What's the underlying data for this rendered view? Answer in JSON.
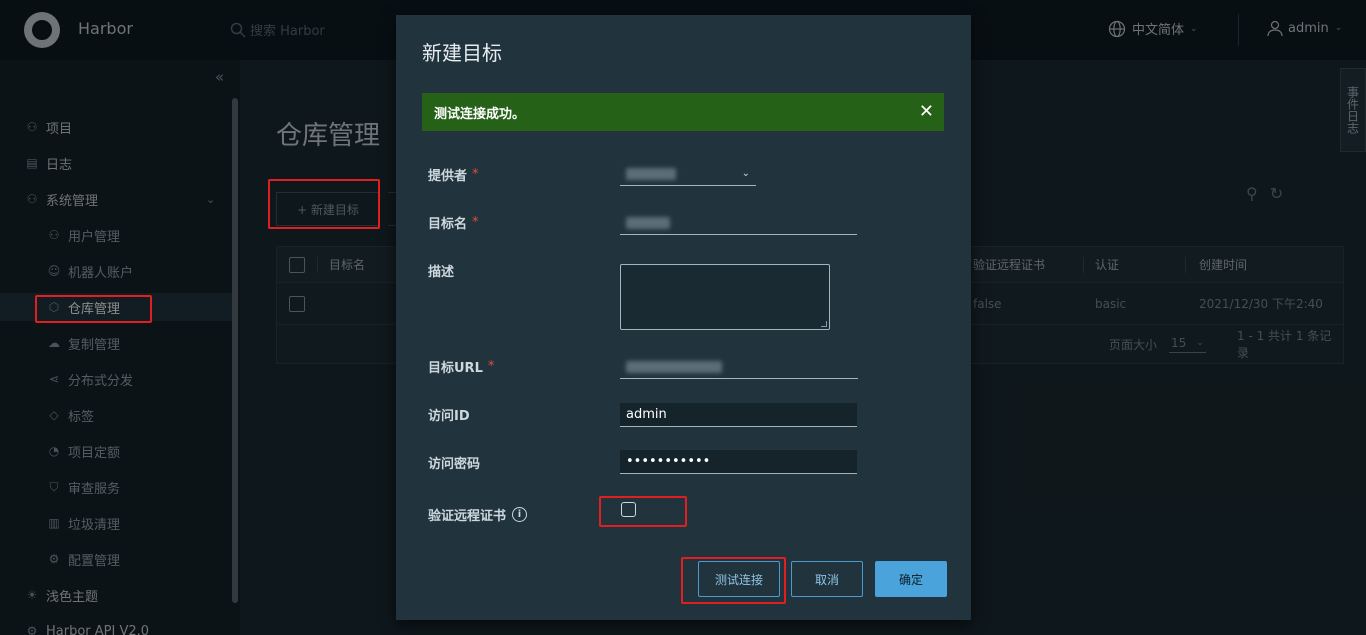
{
  "header": {
    "app_title": "Harbor",
    "search_placeholder": "搜索 Harbor",
    "language": "中文简体",
    "user": "admin"
  },
  "sidebar": {
    "items": [
      {
        "label": "项目",
        "icon": "projects-icon"
      },
      {
        "label": "日志",
        "icon": "logs-icon"
      },
      {
        "label": "系统管理",
        "icon": "admin-icon"
      },
      {
        "label": "用户管理",
        "icon": "users-icon"
      },
      {
        "label": "机器人账户",
        "icon": "robot-icon"
      },
      {
        "label": "仓库管理",
        "icon": "registry-icon"
      },
      {
        "label": "复制管理",
        "icon": "replication-icon"
      },
      {
        "label": "分布式分发",
        "icon": "distribution-icon"
      },
      {
        "label": "标签",
        "icon": "tag-icon"
      },
      {
        "label": "项目定额",
        "icon": "quota-icon"
      },
      {
        "label": "审查服务",
        "icon": "shield-icon"
      },
      {
        "label": "垃圾清理",
        "icon": "trash-icon"
      },
      {
        "label": "配置管理",
        "icon": "gear-icon"
      },
      {
        "label": "浅色主题",
        "icon": "sun-icon"
      },
      {
        "label": "Harbor API V2.0",
        "icon": "api-icon"
      }
    ]
  },
  "main": {
    "page_title": "仓库管理",
    "new_target_button": "+ 新建目标",
    "table": {
      "columns": [
        "目标名",
        "验证远程证书",
        "认证",
        "创建时间"
      ],
      "rows": [
        {
          "verify_cert": "false",
          "auth": "basic",
          "created": "2021/12/30 下午2:40"
        }
      ],
      "page_size_label": "页面大小",
      "page_size": "15",
      "summary": "1 - 1 共计 1 条记录"
    },
    "side_tab": "事件日志"
  },
  "modal": {
    "title": "新建目标",
    "alert": "测试连接成功。",
    "fields": {
      "provider_label": "提供者",
      "target_name_label": "目标名",
      "description_label": "描述",
      "url_label": "目标URL",
      "access_id_label": "访问ID",
      "access_id_value": "admin",
      "password_label": "访问密码",
      "password_value": "•••••••••••",
      "verify_cert_label": "验证远程证书"
    },
    "buttons": {
      "test": "测试连接",
      "cancel": "取消",
      "ok": "确定"
    }
  }
}
